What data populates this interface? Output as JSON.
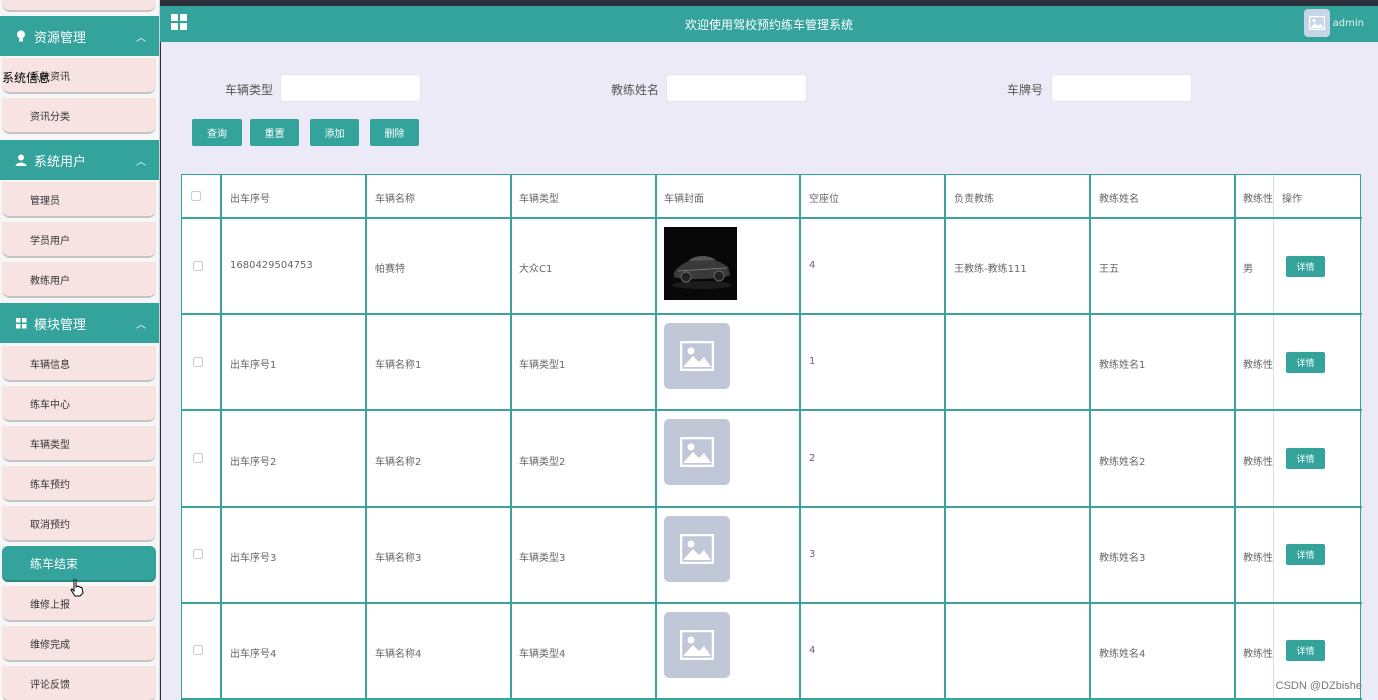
{
  "header": {
    "title": "欢迎使用驾校预约练车管理系统",
    "user": "admin",
    "menu_icon": "grid-icon",
    "avatar_icon": "image-placeholder-icon"
  },
  "sidebar": {
    "top_item_label": "",
    "groups": [
      {
        "label": "资源管理",
        "icon": "lightbulb-icon",
        "items": [
          "系统资讯",
          "资讯分类"
        ],
        "tooltip": "系统信息"
      },
      {
        "label": "系统用户",
        "icon": "user-icon",
        "items": [
          "管理员",
          "学员用户",
          "教练用户"
        ]
      },
      {
        "label": "模块管理",
        "icon": "grid-icon",
        "items": [
          "车辆信息",
          "练车中心",
          "车辆类型",
          "练车预约",
          "取消预约",
          "练车结束",
          "维修上报",
          "维修完成",
          "评论反馈"
        ]
      }
    ],
    "active_item": "练车结束"
  },
  "search": {
    "fields": [
      {
        "label": "车辆类型",
        "value": ""
      },
      {
        "label": "教练姓名",
        "value": ""
      },
      {
        "label": "车牌号",
        "value": ""
      }
    ],
    "buttons": [
      "查询",
      "重置",
      "添加",
      "删除"
    ]
  },
  "table": {
    "headers": [
      "出车序号",
      "车辆名称",
      "车辆类型",
      "车辆封面",
      "空座位",
      "负责教练",
      "教练姓名",
      "教练性",
      "操作"
    ],
    "rows": [
      {
        "serial": "1680429504753",
        "name": "帕赛特",
        "type": "大众C1",
        "cover": "car-photo",
        "seats": "4",
        "coach": "王教练-教练111",
        "coach_name": "王五",
        "gender": "男",
        "action": "详情"
      },
      {
        "serial": "出车序号1",
        "name": "车辆名称1",
        "type": "车辆类型1",
        "cover": "placeholder",
        "seats": "1",
        "coach": "",
        "coach_name": "教练姓名1",
        "gender": "教练性",
        "action": "详情"
      },
      {
        "serial": "出车序号2",
        "name": "车辆名称2",
        "type": "车辆类型2",
        "cover": "placeholder",
        "seats": "2",
        "coach": "",
        "coach_name": "教练姓名2",
        "gender": "教练性",
        "action": "详情"
      },
      {
        "serial": "出车序号3",
        "name": "车辆名称3",
        "type": "车辆类型3",
        "cover": "placeholder",
        "seats": "3",
        "coach": "",
        "coach_name": "教练姓名3",
        "gender": "教练性",
        "action": "详情"
      },
      {
        "serial": "出车序号4",
        "name": "车辆名称4",
        "type": "车辆类型4",
        "cover": "placeholder",
        "seats": "4",
        "coach": "",
        "coach_name": "教练姓名4",
        "gender": "教练性",
        "action": "详情"
      }
    ]
  },
  "watermark": "CSDN @DZbishe",
  "colors": {
    "accent": "#33a39b",
    "background": "#eceaf6",
    "sidebar_item": "#f7e3e1"
  }
}
